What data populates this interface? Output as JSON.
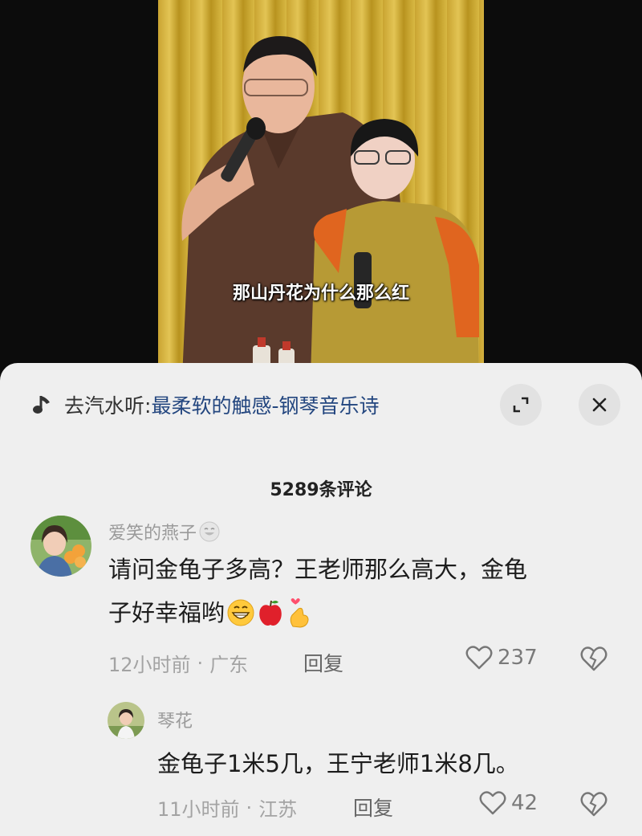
{
  "video": {
    "subtitle": "那山丹花为什么那么红"
  },
  "music_bar": {
    "icon": "music-note-icon",
    "prefix": "去汽水听: ",
    "title": "最柔软的触感-钢琴音乐诗",
    "expand_icon": "expand-icon",
    "close_icon": "close-icon"
  },
  "comments_header": {
    "count_label": "5289条评论"
  },
  "comments": [
    {
      "username": "爱笑的燕子",
      "username_emoji": "grin-face-emoji",
      "text_line1": "请问金龟子多高？王老师那么高大，金龟",
      "text_line2": "子好幸福哟",
      "text_emojis": [
        "grin-face-emoji",
        "apple-emoji",
        "heart-hand-emoji"
      ],
      "time": "12小时前",
      "separator": "·",
      "location": "广东",
      "reply_label": "回复",
      "likes": "237"
    },
    {
      "username": "琴花",
      "text_line1": "金龟子1米5几，王宁老师1米8几。",
      "time": "11小时前",
      "separator": "·",
      "location": "江苏",
      "reply_label": "回复",
      "likes": "42"
    }
  ],
  "colors": {
    "sheet_bg": "#efefef",
    "music_link": "#23467f",
    "meta_gray": "#a3a3a3",
    "curtain_gold": "#d8b843"
  }
}
